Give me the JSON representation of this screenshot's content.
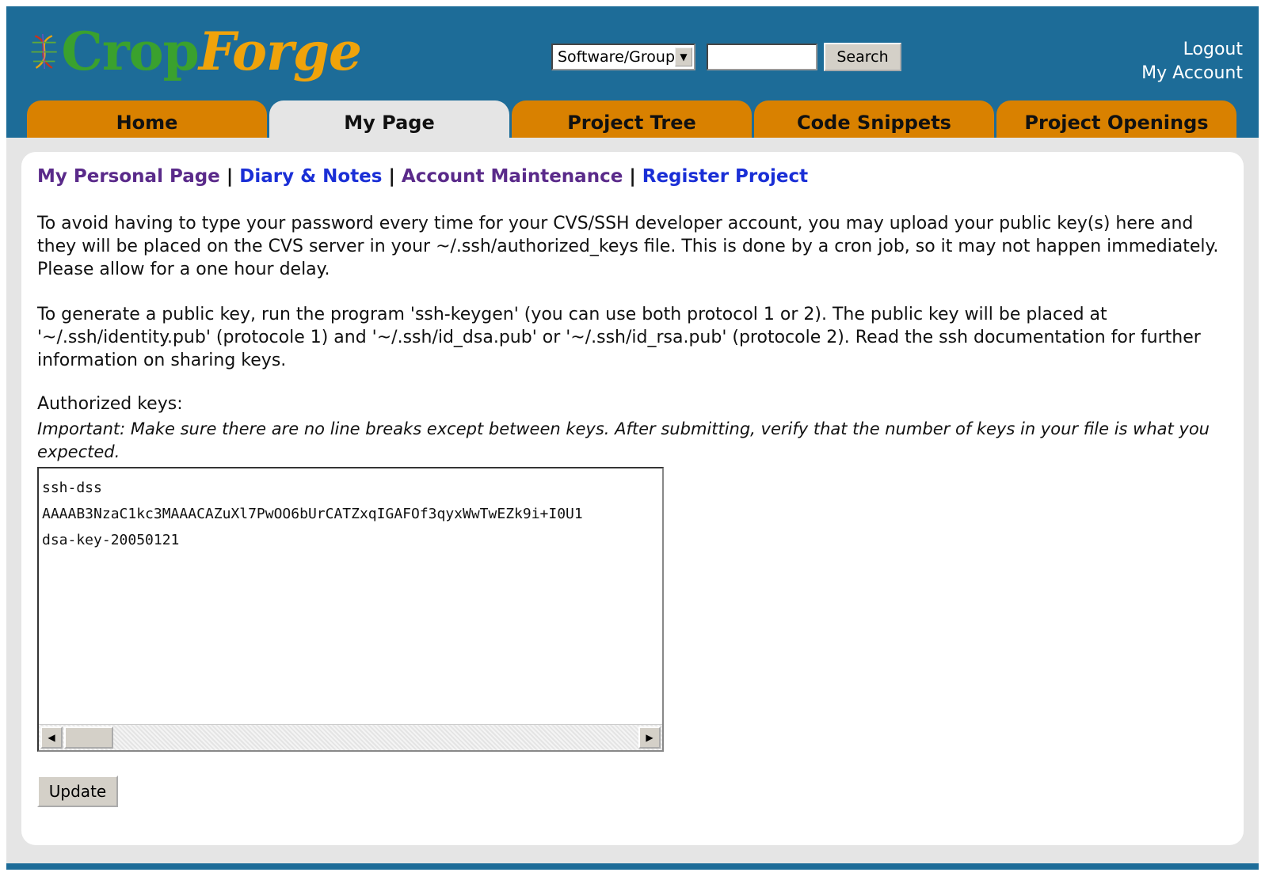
{
  "brand": {
    "name_part1": "Crop",
    "name_part2": "Forge"
  },
  "search": {
    "scope_selected": "Software/Group",
    "query": "",
    "button_label": "Search"
  },
  "account": {
    "logout": "Logout",
    "my_account": "My Account"
  },
  "tabs": [
    {
      "label": "Home",
      "active": false
    },
    {
      "label": "My Page",
      "active": true
    },
    {
      "label": "Project Tree",
      "active": false
    },
    {
      "label": "Code Snippets",
      "active": false
    },
    {
      "label": "Project Openings",
      "active": false
    }
  ],
  "subnav": {
    "items": [
      "My Personal Page",
      "Diary & Notes",
      "Account Maintenance",
      "Register Project"
    ],
    "separator": "|"
  },
  "intro_paragraph": "To avoid having to type your password every time for your CVS/SSH developer account, you may upload your public key(s) here and they will be placed on the CVS server in your ~/.ssh/authorized_keys file. This is done by a cron job, so it may not happen immediately. Please allow for a one hour delay.",
  "generate_paragraph": "To generate a public key, run the program 'ssh-keygen' (you can use both protocol 1 or 2). The public key will be placed at '~/.ssh/identity.pub' (protocole 1) and '~/.ssh/id_dsa.pub' or '~/.ssh/id_rsa.pub' (protocole 2). Read the ssh documentation for further information on sharing keys.",
  "keys_form": {
    "label": "Authorized keys:",
    "note": "Important: Make sure there are no line breaks except between keys. After submitting, verify that the number of keys in your file is what you expected.",
    "value": "ssh-dss\nAAAAB3NzaC1kc3MAAACAZuXl7PwOO6bUrCATZxqIGAFOf3qyxWwTwEZk9i+I0U1\ndsa-key-20050121",
    "update_label": "Update"
  }
}
